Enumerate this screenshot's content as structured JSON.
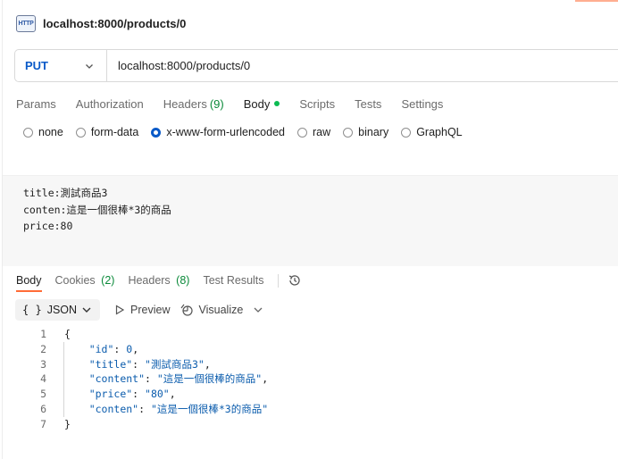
{
  "request": {
    "icon_label": "HTTP",
    "name": "localhost:8000/products/0",
    "method": "PUT",
    "url": "localhost:8000/products/0"
  },
  "request_tabs": [
    {
      "label": "Params"
    },
    {
      "label": "Authorization"
    },
    {
      "label": "Headers",
      "count": "(9)"
    },
    {
      "label": "Body",
      "has_dot": true
    },
    {
      "label": "Scripts"
    },
    {
      "label": "Tests"
    },
    {
      "label": "Settings"
    }
  ],
  "body_types": [
    {
      "label": "none",
      "selected": false
    },
    {
      "label": "form-data",
      "selected": false
    },
    {
      "label": "x-www-form-urlencoded",
      "selected": true
    },
    {
      "label": "raw",
      "selected": false
    },
    {
      "label": "binary",
      "selected": false
    },
    {
      "label": "GraphQL",
      "selected": false
    }
  ],
  "raw_body": [
    "title:測試商品3",
    "conten:這是一個很棒*3的商品",
    "price:80"
  ],
  "response_tabs": [
    {
      "label": "Body",
      "count": ""
    },
    {
      "label": "Cookies",
      "count": "(2)"
    },
    {
      "label": "Headers",
      "count": "(8)"
    },
    {
      "label": "Test Results",
      "count": ""
    }
  ],
  "response_toolbar": {
    "format_label": "JSON",
    "preview_label": "Preview",
    "visualize_label": "Visualize"
  },
  "response_code": {
    "line_numbers": [
      "1",
      "2",
      "3",
      "4",
      "5",
      "6",
      "7"
    ],
    "open": "{",
    "close": "}",
    "fields": [
      {
        "key": "\"id\"",
        "value": "0",
        "sep": ","
      },
      {
        "key": "\"title\"",
        "value": "\"測試商品3\"",
        "sep": ","
      },
      {
        "key": "\"content\"",
        "value": "\"這是一個很棒的商品\"",
        "sep": ","
      },
      {
        "key": "\"price\"",
        "value": "\"80\"",
        "sep": ","
      },
      {
        "key": "\"conten\"",
        "value": "\"這是一個很棒*3的商品\"",
        "sep": ""
      }
    ]
  },
  "colors": {
    "accent": "#ff6c37",
    "method": "#0a5ac8",
    "success": "#0cbb52"
  }
}
